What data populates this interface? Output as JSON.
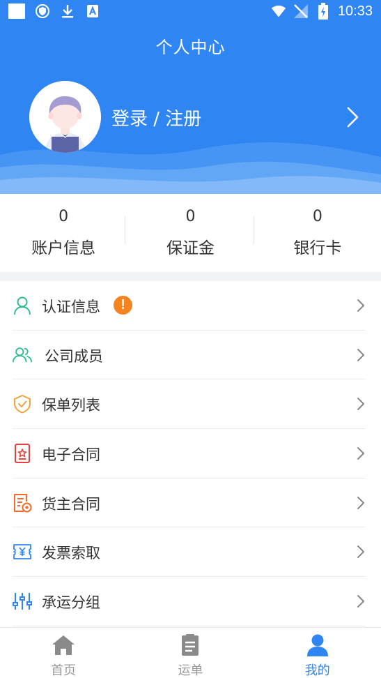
{
  "status_bar": {
    "time": "10:33"
  },
  "header": {
    "title": "个人中心",
    "login_label": "登录 / 注册"
  },
  "stats": [
    {
      "value": "0",
      "label": "账户信息"
    },
    {
      "value": "0",
      "label": "保证金"
    },
    {
      "value": "0",
      "label": "银行卡"
    }
  ],
  "menu": [
    {
      "label": "认证信息",
      "icon": "person-icon",
      "icon_color": "#2ebd8a"
    },
    {
      "label": "公司成员",
      "icon": "group-icon",
      "icon_color": "#2ebd8a"
    },
    {
      "label": "保单列表",
      "icon": "shield-check-icon",
      "icon_color": "#f2a33a"
    },
    {
      "label": "电子合同",
      "icon": "contract-star-icon",
      "icon_color": "#e8413d"
    },
    {
      "label": "货主合同",
      "icon": "document-badge-icon",
      "icon_color": "#f26b2a"
    },
    {
      "label": "发票索取",
      "icon": "invoice-yen-icon",
      "icon_color": "#2f86f2"
    },
    {
      "label": "承运分组",
      "icon": "sliders-icon",
      "icon_color": "#2f86f2"
    }
  ],
  "menu_badge": "!",
  "bottom_nav": [
    {
      "label": "首页",
      "icon": "home-icon",
      "active": false
    },
    {
      "label": "运单",
      "icon": "clipboard-icon",
      "active": false
    },
    {
      "label": "我的",
      "icon": "user-icon",
      "active": true
    }
  ],
  "colors": {
    "brand_blue": "#2f86f2",
    "warning_orange": "#f5831f",
    "inactive_gray": "#999999"
  }
}
